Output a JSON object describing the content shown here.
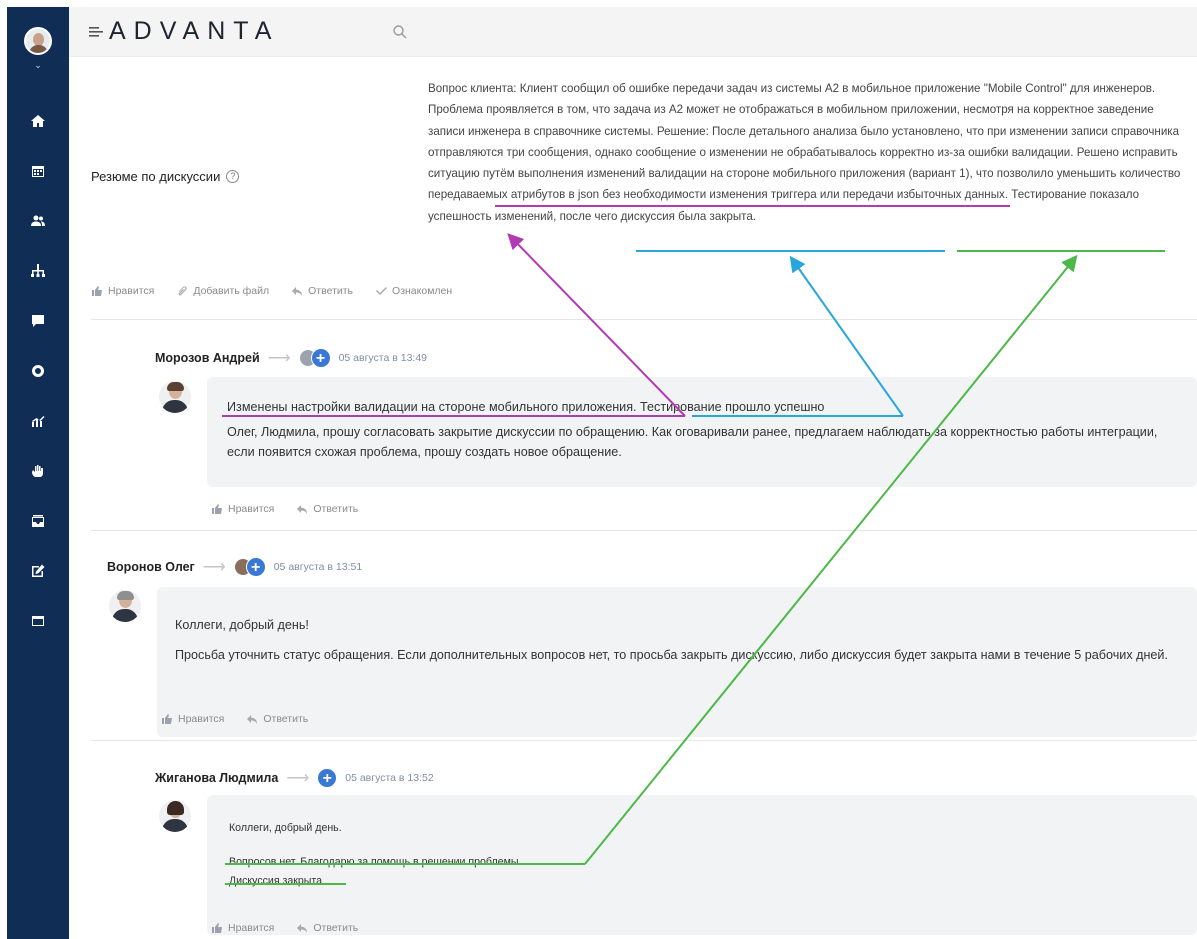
{
  "app": {
    "logo": "ADVANTA"
  },
  "summary": {
    "label": "Резюме по дискуссии",
    "text": "Вопрос клиента: Клиент сообщил об ошибке передачи задач из системы А2 в мобильное приложение \"Mobile Control\" для инженеров. Проблема проявляется в том, что задача из А2 может не отображаться в мобильном приложении, несмотря на корректное заведение записи инженера в справочнике системы. Решение: После детального анализа было установлено, что при изменении записи справочника отправляются три сообщения, однако сообщение о изменении не обрабатывалось корректно из-за ошибки валидации. Решено исправить ситуацию путём выполнения изменений валидации на стороне мобильного приложения (вариант 1), что позволило уменьшить количество передаваемых атрибутов в json без необходимости изменения триггера или передачи избыточных данных. Тестирование показало успешность изменений, после чего дискуссия была закрыта.",
    "actions": {
      "like": "Нравится",
      "attach": "Добавить файл",
      "reply": "Ответить",
      "ack": "Ознакомлен"
    }
  },
  "comments": [
    {
      "author": "Морозов Андрей",
      "date": "05 августа в 13:49",
      "lines": [
        "Изменены настройки валидации на стороне мобильного приложения. Тестирование прошло успешно",
        "Олег, Людмила, прошу согласовать закрытие дискуссии по обращению. Как оговаривали ранее, предлагаем наблюдать за корректностью работы интеграции, если появится схожая проблема, прошу создать новое обращение."
      ],
      "actions": {
        "like": "Нравится",
        "reply": "Ответить"
      }
    },
    {
      "author": "Воронов Олег",
      "date": "05 августа в 13:51",
      "lines": [
        "Коллеги, добрый день!",
        "Просьба уточнить статус обращения. Если дополнительных вопросов нет, то просьба закрыть дискуссию, либо дискуссия будет закрыта нами в течение 5 рабочих дней."
      ],
      "actions": {
        "like": "Нравится",
        "reply": "Ответить"
      }
    },
    {
      "author": "Жиганова Людмила",
      "date": "05 августа в 13:52",
      "lines": [
        "Коллеги, добрый день.",
        "Вопросов нет. Благодарю за помощь в решении проблемы.",
        "Дискуссия закрыта"
      ],
      "actions": {
        "like": "Нравится",
        "reply": "Ответить"
      }
    }
  ],
  "colors": {
    "sidebar": "#0f2d55",
    "accent": "#3a78d6",
    "annot_purple": "#b23bb4",
    "annot_blue": "#2aa6de",
    "annot_green": "#4cb848"
  },
  "icons": [
    "home-icon",
    "calendar-icon",
    "users-icon",
    "org-icon",
    "chat-icon",
    "circle-icon",
    "chart-icon",
    "hand-icon",
    "inbox-icon",
    "edit-icon",
    "window-icon"
  ]
}
